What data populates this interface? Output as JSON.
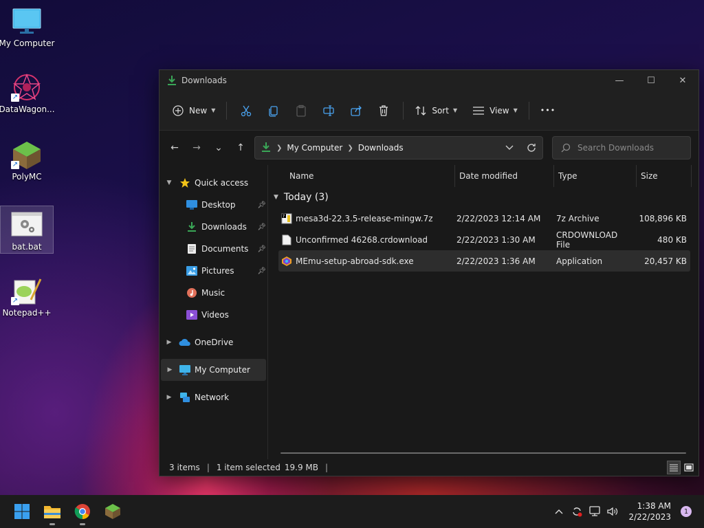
{
  "desktop": {
    "icons": [
      {
        "label": "My Computer"
      },
      {
        "label": "DataWagon..."
      },
      {
        "label": "PolyMC"
      },
      {
        "label": "bat.bat"
      },
      {
        "label": "Notepad++"
      }
    ]
  },
  "window": {
    "title": "Downloads",
    "controls": {
      "minimize": "—",
      "maximize": "☐",
      "close": "✕"
    },
    "toolbar": {
      "new_label": "New",
      "sort_label": "Sort",
      "view_label": "View",
      "more_label": "•••"
    },
    "nav": {
      "back": "←",
      "forward": "→",
      "recent": "⌄",
      "up": "↑"
    },
    "address": {
      "crumbs": [
        "My Computer",
        "Downloads"
      ]
    },
    "search": {
      "placeholder": "Search Downloads"
    },
    "sidebar": {
      "quick_access": "Quick access",
      "quick_items": [
        {
          "label": "Desktop"
        },
        {
          "label": "Downloads"
        },
        {
          "label": "Documents"
        },
        {
          "label": "Pictures"
        },
        {
          "label": "Music"
        },
        {
          "label": "Videos"
        }
      ],
      "onedrive": "OneDrive",
      "my_computer": "My Computer",
      "network": "Network"
    },
    "columns": {
      "name": "Name",
      "date": "Date modified",
      "type": "Type",
      "size": "Size"
    },
    "group": {
      "label": "Today (3)"
    },
    "files": [
      {
        "name": "mesa3d-22.3.5-release-mingw.7z",
        "date": "2/22/2023 12:14 AM",
        "type": "7z Archive",
        "size": "108,896 KB"
      },
      {
        "name": "Unconfirmed 46268.crdownload",
        "date": "2/22/2023 1:30 AM",
        "type": "CRDOWNLOAD File",
        "size": "480 KB"
      },
      {
        "name": "MEmu-setup-abroad-sdk.exe",
        "date": "2/22/2023 1:36 AM",
        "type": "Application",
        "size": "20,457 KB"
      }
    ],
    "status": {
      "items": "3 items",
      "selected": "1 item selected",
      "size": "19.9 MB",
      "bar": "|"
    }
  },
  "taskbar": {
    "time": "1:38 AM",
    "date": "2/22/2023",
    "notifications": "1"
  },
  "colors": {
    "accent": "#3aa757",
    "folder_blue": "#2f8fe0",
    "selection": "#2d2d2d"
  }
}
